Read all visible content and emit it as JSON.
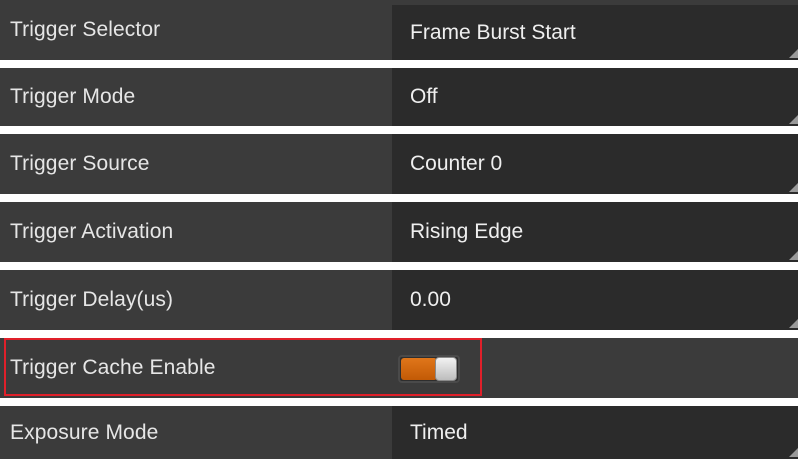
{
  "parameters": [
    {
      "label": "Trigger Selector",
      "value": "Frame Burst Start"
    },
    {
      "label": "Trigger Mode",
      "value": "Off"
    },
    {
      "label": "Trigger Source",
      "value": "Counter 0"
    },
    {
      "label": "Trigger Activation",
      "value": "Rising Edge"
    },
    {
      "label": "Trigger Delay(us)",
      "value": "0.00"
    },
    {
      "label": "Trigger Cache Enable",
      "value": "On"
    },
    {
      "label": "Exposure Mode",
      "value": "Timed"
    }
  ],
  "colors": {
    "row_background": "#3b3b3b",
    "value_background": "#2b2b2b",
    "toggle_on": "#d2650f",
    "highlight": "#e0202a"
  }
}
